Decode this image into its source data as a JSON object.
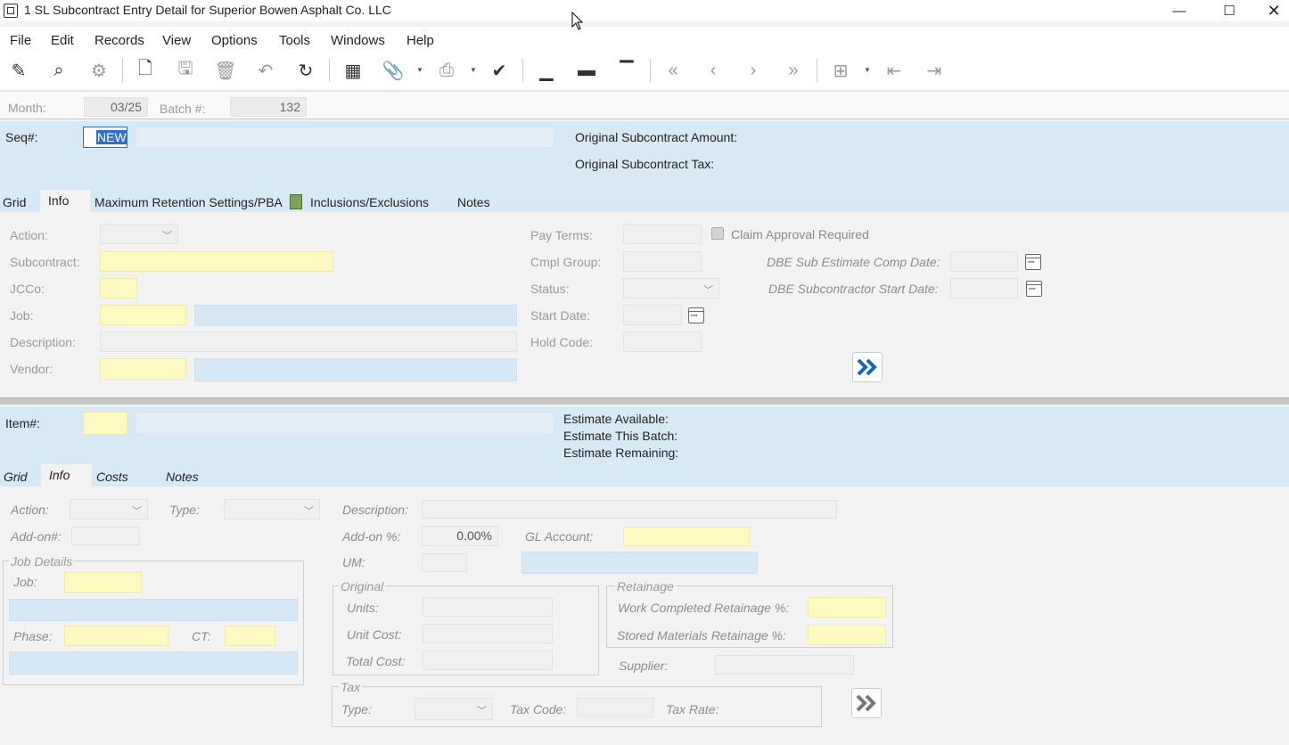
{
  "window": {
    "title": "1 SL Subcontract Entry Detail for Superior Bowen  Asphalt Co. LLC"
  },
  "menu": [
    "File",
    "Edit",
    "Records",
    "View",
    "Options",
    "Tools",
    "Windows",
    "Help"
  ],
  "header": {
    "month_label": "Month:",
    "month_value": "03/25",
    "batch_label": "Batch #:",
    "batch_value": "132"
  },
  "top": {
    "seq_label": "Seq#:",
    "seq_value": "NEW",
    "orig_amount_label": "Original Subcontract Amount:",
    "orig_tax_label": "Original Subcontract Tax:",
    "tabs": [
      "Grid",
      "Info",
      "Maximum Retention Settings/PBA",
      "Inclusions/Exclusions",
      "Notes"
    ],
    "active_tab": "Info"
  },
  "info": {
    "action_label": "Action:",
    "subcontract_label": "Subcontract:",
    "jcco_label": "JCCo:",
    "job_label": "Job:",
    "description_label": "Description:",
    "vendor_label": "Vendor:",
    "pay_terms_label": "Pay Terms:",
    "cmpl_group_label": "Cmpl Group:",
    "status_label": "Status:",
    "start_date_label": "Start Date:",
    "hold_code_label": "Hold Code:",
    "claim_approval_label": "Claim Approval Required",
    "dbe_comp_label": "DBE Sub Estimate Comp Date:",
    "dbe_start_label": "DBE Subcontractor Start Date:"
  },
  "item": {
    "item_label": "Item#:",
    "est_available_label": "Estimate Available:",
    "est_batch_label": "Estimate This Batch:",
    "est_remaining_label": "Estimate Remaining:",
    "tabs": [
      "Grid",
      "Info",
      "Costs",
      "Notes"
    ],
    "active_tab": "Info"
  },
  "item_info": {
    "action_label": "Action:",
    "type_label": "Type:",
    "description_label": "Description:",
    "addon_num_label": "Add-on#:",
    "addon_pct_label": "Add-on %:",
    "addon_pct_value": "0.00%",
    "gl_account_label": "GL Account:",
    "um_label": "UM:",
    "job_details_title": "Job Details",
    "job_label": "Job:",
    "phase_label": "Phase:",
    "ct_label": "CT:",
    "original_title": "Original",
    "units_label": "Units:",
    "unit_cost_label": "Unit Cost:",
    "total_cost_label": "Total Cost:",
    "retainage_title": "Retainage",
    "work_ret_label": "Work Completed Retainage %:",
    "stored_ret_label": "Stored Materials Retainage %:",
    "supplier_label": "Supplier:",
    "tax_title": "Tax",
    "tax_type_label": "Type:",
    "tax_code_label": "Tax Code:",
    "tax_rate_label": "Tax Rate:"
  },
  "colors": {
    "panel_blue": "#d8e9f6",
    "required_yellow": "#fff9c2",
    "accent_blue": "#1565c0"
  }
}
